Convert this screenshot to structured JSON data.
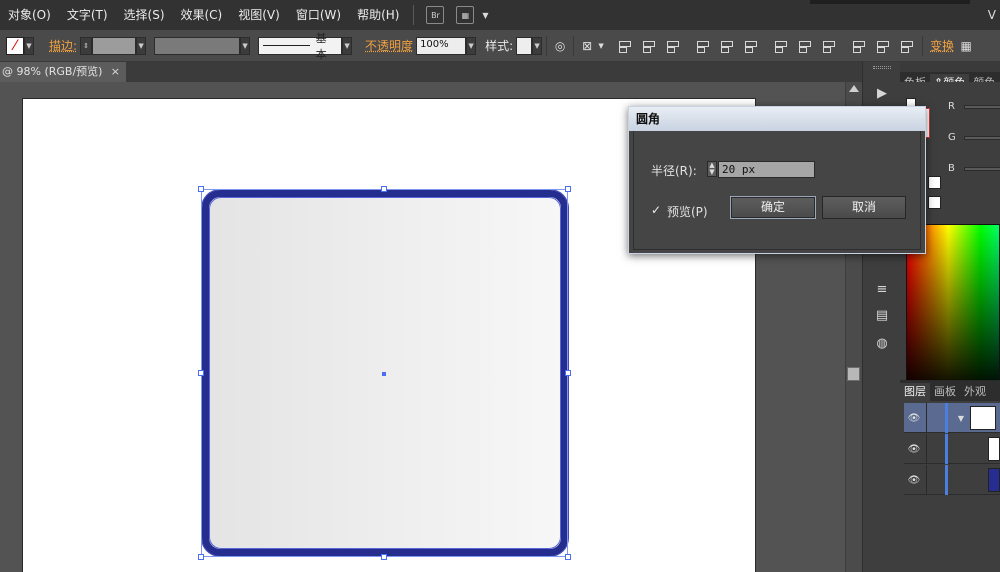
{
  "menu": {
    "items": [
      "对象(O)",
      "文字(T)",
      "选择(S)",
      "效果(C)",
      "视图(V)",
      "窗口(W)",
      "帮助(H)"
    ],
    "bridge_icon": "Br",
    "right_label": "V"
  },
  "control": {
    "stroke_label": "描边:",
    "stroke_style": "基本",
    "opacity_label": "不透明度",
    "opacity_value": "100%",
    "style_label": "样式:",
    "transform_label": "变换"
  },
  "document": {
    "tab_title": "@ 98% (RGB/预览)",
    "close": "×"
  },
  "dialog": {
    "title": "圆角",
    "radius_label": "半径(R):",
    "radius_value": "20 px",
    "preview_label": "预览(P)",
    "preview_checked": true,
    "ok_label": "确定",
    "cancel_label": "取消"
  },
  "panels": {
    "color_tabs": [
      "色板",
      "颜色",
      "颜色"
    ],
    "channels": [
      "R",
      "G",
      "B"
    ],
    "layer_tabs": [
      "图层",
      "画板",
      "外观"
    ]
  },
  "colors": {
    "shape_stroke": "#252d8e",
    "selection": "#4b6ff0",
    "orange_label": "#f0a040"
  }
}
